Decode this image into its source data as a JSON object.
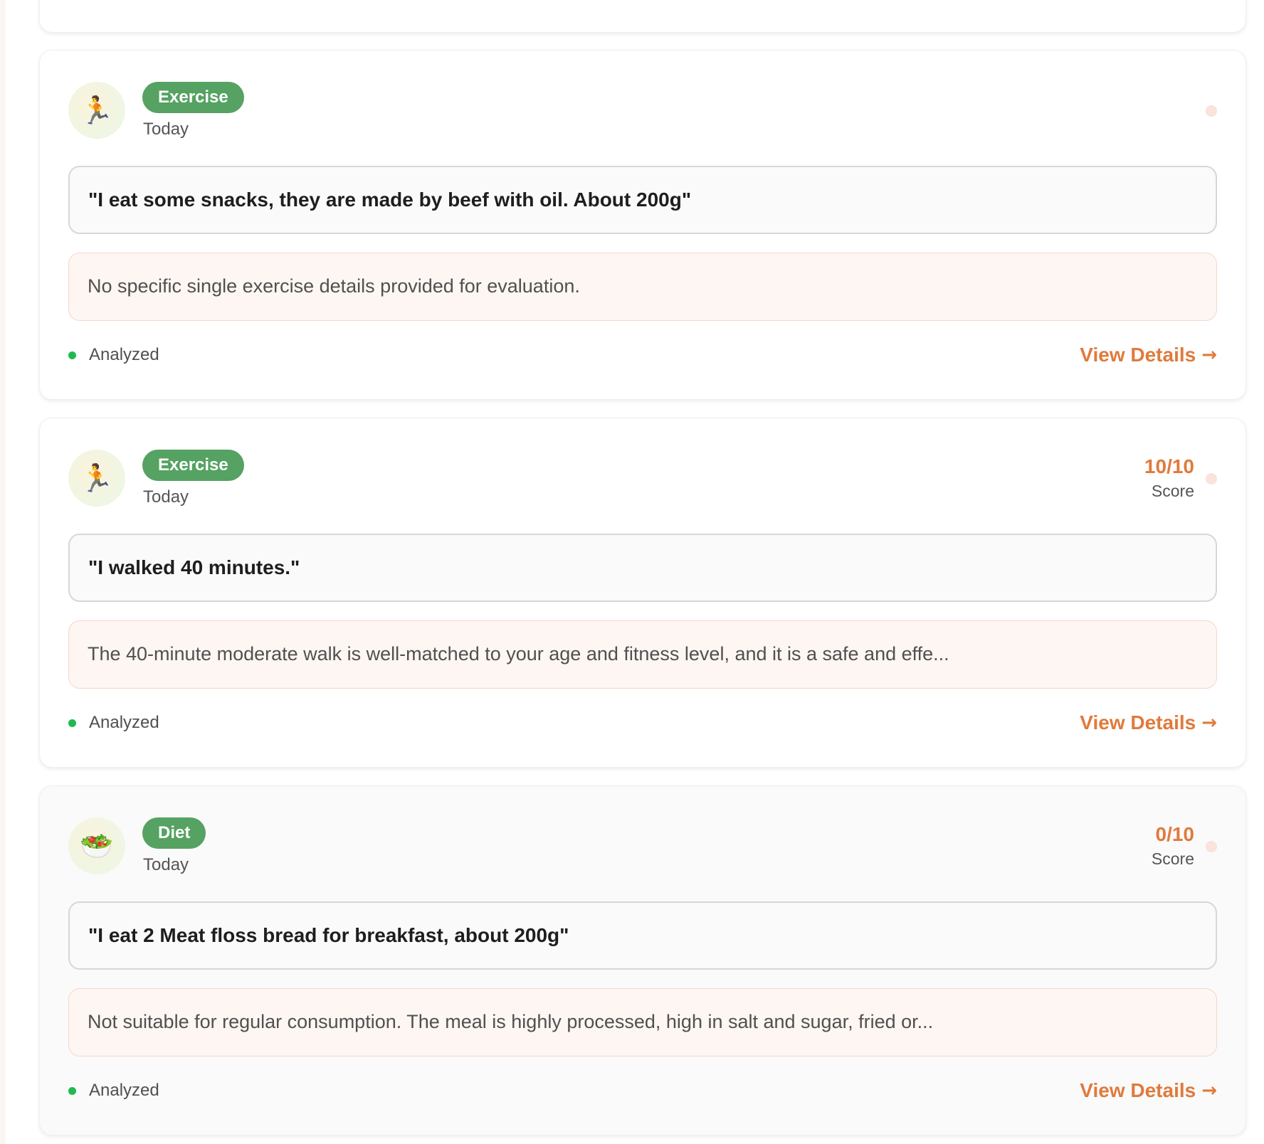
{
  "colors": {
    "accent": "#e07a3c",
    "tag_green": "#55a262",
    "status_green": "#1fba4d",
    "analysis_bg": "#fdf6f2"
  },
  "entries": [
    {
      "category": "Exercise",
      "icon": "running-person-icon",
      "icon_glyph": "🏃",
      "date": "Today",
      "score_value": "",
      "score_label": "",
      "quote": "\"I eat some snacks, they are made by beef with oil. About 200g\"",
      "analysis": "No specific single exercise details provided for evaluation.",
      "status": "Analyzed",
      "action": "View Details",
      "action_arrow": "→"
    },
    {
      "category": "Exercise",
      "icon": "running-person-icon",
      "icon_glyph": "🏃",
      "date": "Today",
      "score_value": "10/10",
      "score_label": "Score",
      "quote": "\"I walked 40 minutes.\"",
      "analysis": "The 40-minute moderate walk is well-matched to your age and fitness level, and it is a safe and effe...",
      "status": "Analyzed",
      "action": "View Details",
      "action_arrow": "→"
    },
    {
      "category": "Diet",
      "icon": "salad-bowl-icon",
      "icon_glyph": "🥗",
      "date": "Today",
      "score_value": "0/10",
      "score_label": "Score",
      "quote": "\"I eat 2 Meat floss bread for breakfast, about 200g\"",
      "analysis": "Not suitable for regular consumption. The meal is highly processed, high in salt and sugar, fried or...",
      "status": "Analyzed",
      "action": "View Details",
      "action_arrow": "→"
    }
  ]
}
